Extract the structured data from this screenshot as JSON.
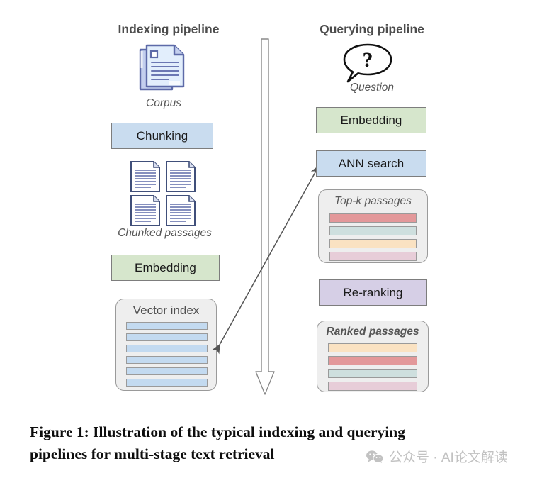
{
  "figure": {
    "columns": {
      "indexing": {
        "title": "Indexing pipeline",
        "corpus_icon": "documents-stack-icon",
        "corpus_caption": "Corpus",
        "chunking_label": "Chunking",
        "chunks_icon": "four-documents-icon",
        "chunks_caption": "Chunked passages",
        "embedding_label": "Embedding",
        "vector_index": {
          "title": "Vector index",
          "rows": 6,
          "row_color": "#c3daf0"
        }
      },
      "querying": {
        "title": "Querying pipeline",
        "question_icon": "speech-bubble-question-icon",
        "question_caption": "Question",
        "embedding_label": "Embedding",
        "ann_search_label": "ANN search",
        "topk": {
          "title": "Top-k passages",
          "bars": [
            "#e3989a",
            "#cedfde",
            "#fae2c2",
            "#e7cdd8"
          ]
        },
        "reranking_label": "Re-ranking",
        "ranked": {
          "title": "Ranked passages",
          "bars": [
            "#fae2c2",
            "#e3989a",
            "#cedfde",
            "#e7cdd8"
          ]
        }
      }
    },
    "arrows": {
      "center_flow": "down-block-arrow",
      "index_query_link": "double-headed-diagonal-arrow"
    },
    "colors": {
      "blue_box": "#c9dcef",
      "green_box": "#d6e6cc",
      "purple_box": "#d6cfe6",
      "card_bg": "#eeeeee",
      "outline": "#8c8c8c"
    }
  },
  "caption": {
    "line1": "Figure 1: Illustration of the typical indexing and querying",
    "line2": "pipelines for multi-stage text retrieval"
  },
  "watermark": {
    "icon": "wechat-logo-icon",
    "text": "公众号 · AI论文解读"
  }
}
